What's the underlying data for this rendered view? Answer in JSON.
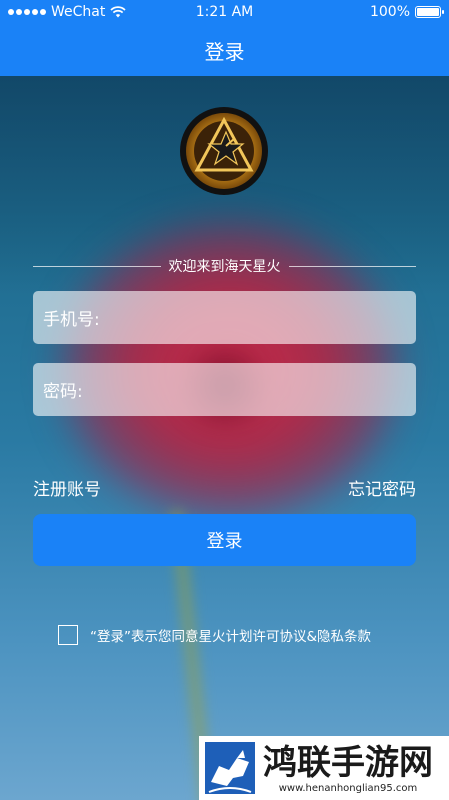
{
  "status_bar": {
    "carrier": "WeChat",
    "time": "1:21 AM",
    "battery_percent": "100%",
    "battery_level": 1.0,
    "signal_icon": "signal-dots-icon",
    "wifi_icon": "wifi-icon",
    "battery_icon": "battery-icon"
  },
  "nav": {
    "title": "登录"
  },
  "logo": {
    "icon": "star-emblem-logo"
  },
  "welcome": {
    "text": "欢迎来到海天星火"
  },
  "form": {
    "phone_label": "手机号:",
    "phone_value": "",
    "password_label": "密码:",
    "password_value": ""
  },
  "links": {
    "register": "注册账号",
    "forgot": "忘记密码"
  },
  "login_button": {
    "label": "登录"
  },
  "agreement": {
    "checked": false,
    "text": "“登录”表示您同意星火计划许可协议&隐私条款"
  },
  "watermark": {
    "title": "鸿联手游网",
    "url": "www.henanhonglian95.com",
    "icon": "bull-logo"
  },
  "colors": {
    "accent": "#1a82f7",
    "field_bg": "rgba(255,255,255,0.6)"
  }
}
